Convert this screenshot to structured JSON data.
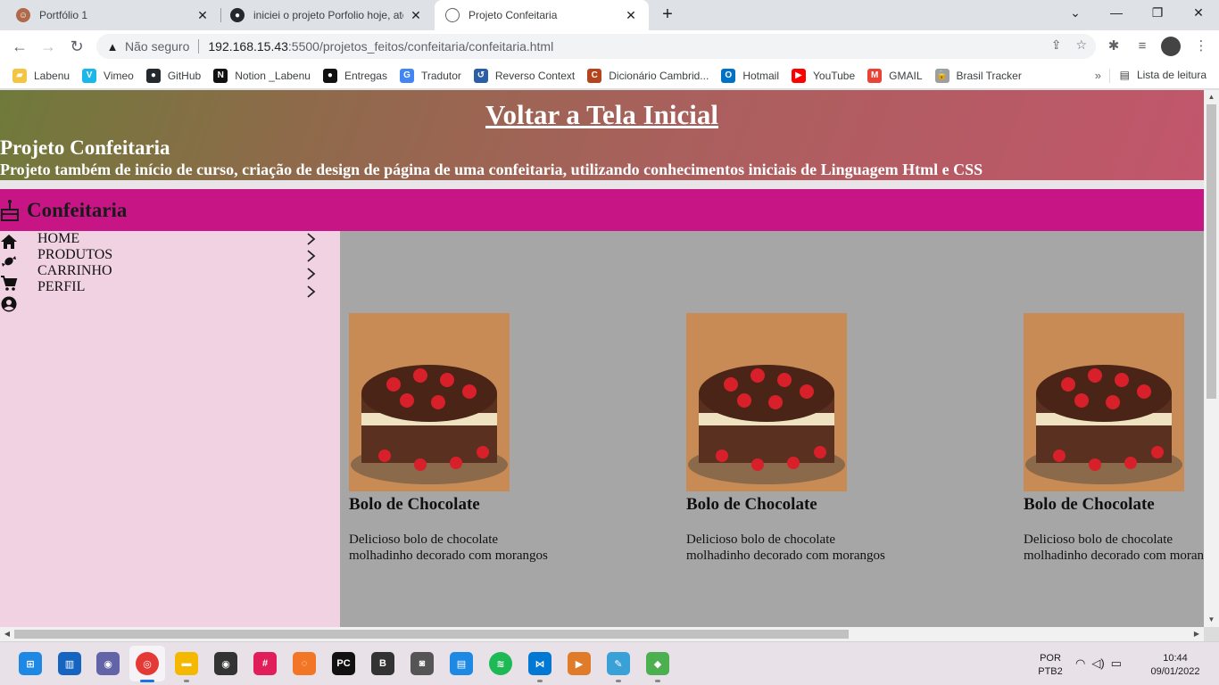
{
  "browser": {
    "tabs": [
      {
        "title": "Portfólio 1",
        "favicon": "person-avatar-icon",
        "active": false
      },
      {
        "title": "iniciei o projeto Porfolio hoje, até",
        "favicon": "github-icon",
        "active": false
      },
      {
        "title": "Projeto Confeitaria",
        "favicon": "globe-icon",
        "active": true
      }
    ],
    "security_label": "Não seguro",
    "url_host": "192.168.15.43",
    "url_path": ":5500/projetos_feitos/confeitaria/confeitaria.html",
    "bookmarks": [
      {
        "label": "Labenu",
        "icon": "folder-icon",
        "color": "#f4c542"
      },
      {
        "label": "Vimeo",
        "icon": "vimeo-icon",
        "color": "#1ab7ea"
      },
      {
        "label": "GitHub",
        "icon": "github-icon",
        "color": "#24292e"
      },
      {
        "label": "Notion _Labenu",
        "icon": "notion-icon",
        "color": "#111111"
      },
      {
        "label": "Entregas",
        "icon": "circle-icon",
        "color": "#111111"
      },
      {
        "label": "Tradutor",
        "icon": "translate-icon",
        "color": "#4285f4"
      },
      {
        "label": "Reverso Context",
        "icon": "reverso-icon",
        "color": "#2a5fa8"
      },
      {
        "label": "Dicionário Cambrid...",
        "icon": "cambridge-icon",
        "color": "#b5441c"
      },
      {
        "label": "Hotmail",
        "icon": "outlook-icon",
        "color": "#0072c6"
      },
      {
        "label": "YouTube",
        "icon": "youtube-icon",
        "color": "#ff0000"
      },
      {
        "label": "GMAIL",
        "icon": "gmail-icon",
        "color": "#ea4335"
      },
      {
        "label": "Brasil Tracker",
        "icon": "lock-icon",
        "color": "#9e9e9e"
      }
    ],
    "more_bookmarks": "»",
    "reading_list": "Lista de leitura"
  },
  "page": {
    "back_link": "Voltar a Tela Inicial",
    "project_title": "Projeto Confeitaria",
    "project_desc": "Projeto também de início de curso, criação de design de página de uma confeitaria, utilizando conhecimentos iniciais de Linguagem Html e CSS",
    "brand_name": "Confeitaria",
    "brand_color": "#c71585",
    "sidebar_color": "#f1d2e2",
    "nav": [
      {
        "label": "HOME",
        "icon": "home-icon"
      },
      {
        "label": "PRODUTOS",
        "icon": "candy-icon"
      },
      {
        "label": "CARRINHO",
        "icon": "cart-icon"
      },
      {
        "label": "PERFIL",
        "icon": "user-circle-icon"
      }
    ],
    "products": [
      {
        "title": "Bolo de Chocolate",
        "desc_line1": "Delicioso bolo de chocolate",
        "desc_line2": "molhadinho decorado com morangos"
      },
      {
        "title": "Bolo de Chocolate",
        "desc_line1": "Delicioso bolo de chocolate",
        "desc_line2": "molhadinho decorado com morangos"
      },
      {
        "title": "Bolo de Chocolate",
        "desc_line1": "Delicioso bolo de chocolate",
        "desc_line2": "molhadinho decorado com morangos"
      }
    ]
  },
  "taskbar": {
    "apps": [
      "windows-start-icon",
      "widgets-icon",
      "teams-chat-icon",
      "chrome-icon",
      "file-explorer-icon",
      "media-player-icon",
      "slack-icon",
      "jupyter-icon",
      "pycharm-icon",
      "b-app-icon",
      "camera-app-icon",
      "notepad-icon",
      "spotify-icon",
      "vscode-icon",
      "video-app-icon",
      "paint-icon",
      "git-icon"
    ],
    "lang_line1": "POR",
    "lang_line2": "PTB2",
    "time": "10:44",
    "date": "09/01/2022"
  }
}
